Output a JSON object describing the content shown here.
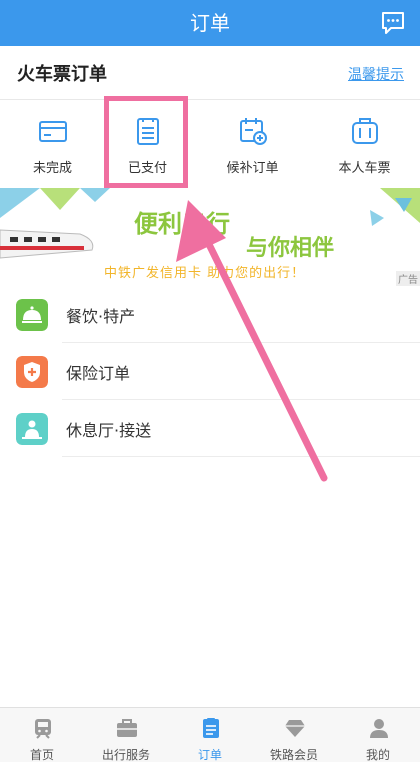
{
  "header": {
    "title": "订单",
    "message_icon": "chat-bubble-icon"
  },
  "section": {
    "title": "火车票订单",
    "tip_link": "温馨提示"
  },
  "tabs": [
    {
      "label": "未完成",
      "icon": "card-icon"
    },
    {
      "label": "已支付",
      "icon": "receipt-icon"
    },
    {
      "label": "候补订单",
      "icon": "calendar-add-icon"
    },
    {
      "label": "本人车票",
      "icon": "suitcase-icon"
    }
  ],
  "banner": {
    "line1": "便利出行",
    "line2": "与你相伴",
    "line3": "中铁广发信用卡 助力您的出行！",
    "ad_tag": "广告"
  },
  "menu": [
    {
      "label": "餐饮·特产",
      "icon": "food-bell-icon",
      "color": "#6cc24a"
    },
    {
      "label": "保险订单",
      "icon": "shield-plus-icon",
      "color": "#f47a4a"
    },
    {
      "label": "休息厅·接送",
      "icon": "lounge-icon",
      "color": "#5ed0c8"
    }
  ],
  "bottom_nav": [
    {
      "label": "首页",
      "icon": "train-icon",
      "active": false
    },
    {
      "label": "出行服务",
      "icon": "briefcase-icon",
      "active": false
    },
    {
      "label": "订单",
      "icon": "order-list-icon",
      "active": true
    },
    {
      "label": "铁路会员",
      "icon": "diamond-icon",
      "active": false
    },
    {
      "label": "我的",
      "icon": "person-icon",
      "active": false
    }
  ],
  "colors": {
    "brand": "#3b98ec",
    "annotation": "#ef6fa0",
    "banner_green": "#8cc63e",
    "banner_yellow": "#f2b52a"
  }
}
